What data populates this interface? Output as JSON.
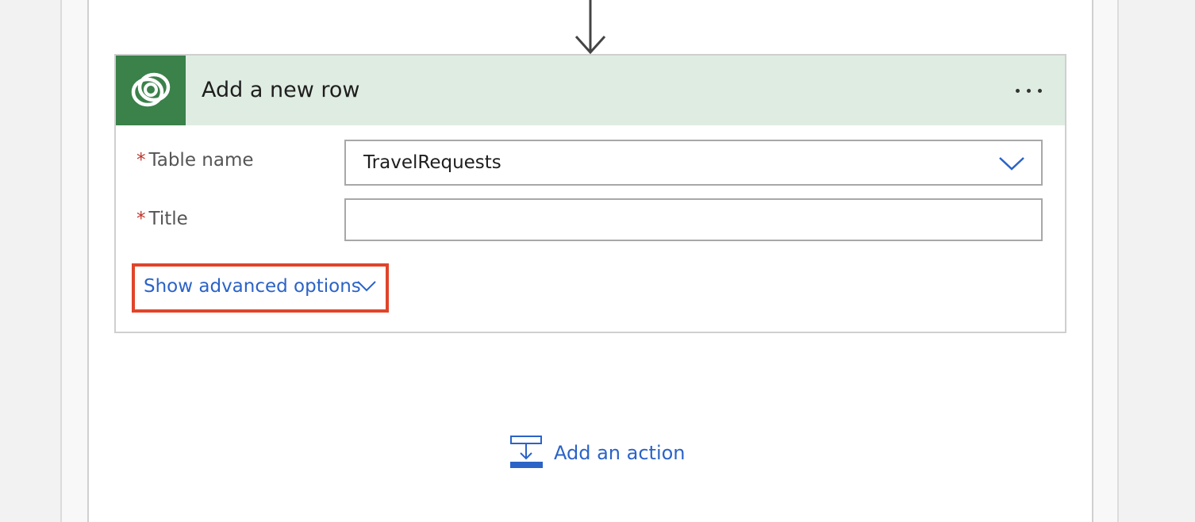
{
  "card": {
    "title": "Add a new row",
    "icon": "dataverse-icon",
    "more_icon": "ellipsis-icon",
    "colors": {
      "header_bg": "#dfece2",
      "icon_bg": "#3a814a"
    }
  },
  "fields": {
    "table_name": {
      "required_marker": "*",
      "label": "Table name",
      "value": "TravelRequests",
      "icon": "chevron-down-icon"
    },
    "title": {
      "required_marker": "*",
      "label": "Title",
      "value": ""
    }
  },
  "advanced": {
    "label": "Show advanced options",
    "icon": "chevron-down-icon",
    "highlight_color": "#e0442a"
  },
  "footer": {
    "add_action_label": "Add an action",
    "add_action_icon": "add-action-icon"
  },
  "colors": {
    "link": "#2b63c7",
    "required": "#c0352b"
  }
}
